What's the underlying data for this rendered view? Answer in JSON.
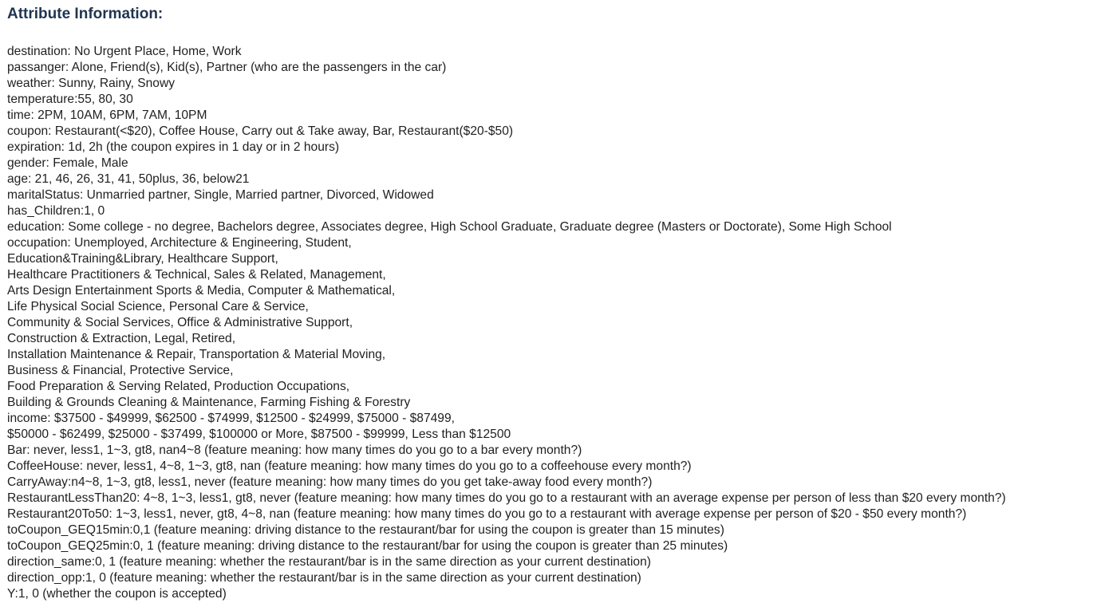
{
  "heading": "Attribute Information:",
  "lines": [
    "destination: No Urgent Place, Home, Work",
    "passanger: Alone, Friend(s), Kid(s), Partner (who are the passengers in the car)",
    "weather: Sunny, Rainy, Snowy",
    "temperature:55, 80, 30",
    "time: 2PM, 10AM, 6PM, 7AM, 10PM",
    "coupon: Restaurant(<$20), Coffee House, Carry out & Take away, Bar, Restaurant($20-$50)",
    "expiration: 1d, 2h (the coupon expires in 1 day or in 2 hours)",
    "gender: Female, Male",
    "age: 21, 46, 26, 31, 41, 50plus, 36, below21",
    "maritalStatus: Unmarried partner, Single, Married partner, Divorced, Widowed",
    "has_Children:1, 0",
    "education: Some college - no degree, Bachelors degree, Associates degree, High School Graduate, Graduate degree (Masters or Doctorate), Some High School",
    "occupation: Unemployed, Architecture & Engineering, Student,",
    "Education&Training&Library, Healthcare Support,",
    "Healthcare Practitioners & Technical, Sales & Related, Management,",
    "Arts Design Entertainment Sports & Media, Computer & Mathematical,",
    "Life Physical Social Science, Personal Care & Service,",
    "Community & Social Services, Office & Administrative Support,",
    "Construction & Extraction, Legal, Retired,",
    "Installation Maintenance & Repair, Transportation & Material Moving,",
    "Business & Financial, Protective Service,",
    "Food Preparation & Serving Related, Production Occupations,",
    "Building & Grounds Cleaning & Maintenance, Farming Fishing & Forestry",
    "income: $37500 - $49999, $62500 - $74999, $12500 - $24999, $75000 - $87499,",
    "$50000 - $62499, $25000 - $37499, $100000 or More, $87500 - $99999, Less than $12500",
    "Bar: never, less1, 1~3, gt8, nan4~8 (feature meaning: how many times do you go to a bar every month?)",
    "CoffeeHouse: never, less1, 4~8, 1~3, gt8, nan (feature meaning: how many times do you go to a coffeehouse every month?)",
    "CarryAway:n4~8, 1~3, gt8, less1, never (feature meaning: how many times do you get take-away food every month?)",
    "RestaurantLessThan20: 4~8, 1~3, less1, gt8, never (feature meaning: how many times do you go to a restaurant with an average expense per person of less than $20 every month?)",
    "Restaurant20To50: 1~3, less1, never, gt8, 4~8, nan (feature meaning: how many times do you go to a restaurant with average expense per person of $20 - $50 every month?)",
    "toCoupon_GEQ15min:0,1 (feature meaning: driving distance to the restaurant/bar for using the coupon is greater than 15 minutes)",
    "toCoupon_GEQ25min:0, 1 (feature meaning: driving distance to the restaurant/bar for using the coupon is greater than 25 minutes)",
    "direction_same:0, 1 (feature meaning: whether the restaurant/bar is in the same direction as your current destination)",
    "direction_opp:1, 0 (feature meaning: whether the restaurant/bar is in the same direction as your current destination)",
    "Y:1, 0 (whether the coupon is accepted)"
  ]
}
